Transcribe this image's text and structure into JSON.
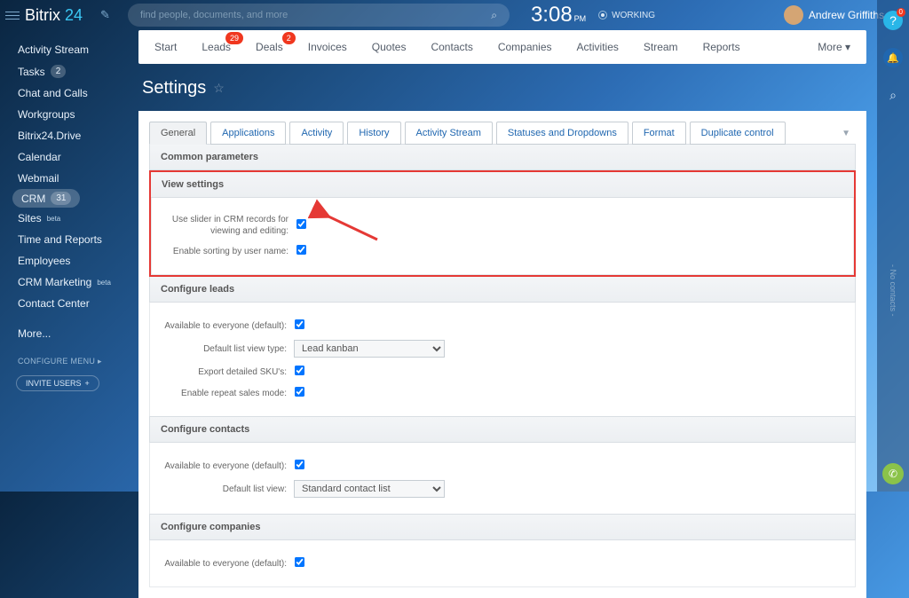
{
  "logo": {
    "a": "Bitrix",
    "b": "24"
  },
  "search": {
    "placeholder": "find people, documents, and more"
  },
  "clock": {
    "time": "3:08",
    "ampm": "PM"
  },
  "status": "WORKING",
  "user": {
    "name": "Andrew Griffiths"
  },
  "rail": {
    "help_badge": "0",
    "vtext": "- No contacts -"
  },
  "sidebar": {
    "items": [
      {
        "label": "Activity Stream"
      },
      {
        "label": "Tasks",
        "badge": "2"
      },
      {
        "label": "Chat and Calls"
      },
      {
        "label": "Workgroups"
      },
      {
        "label": "Bitrix24.Drive"
      },
      {
        "label": "Calendar"
      },
      {
        "label": "Webmail"
      },
      {
        "label": "CRM",
        "badge": "31"
      },
      {
        "label": "Sites",
        "sup": "beta"
      },
      {
        "label": "Time and Reports"
      },
      {
        "label": "Employees"
      },
      {
        "label": "CRM Marketing",
        "sup": "beta"
      },
      {
        "label": "Contact Center"
      },
      {
        "label": "More..."
      }
    ],
    "configure": "CONFIGURE MENU",
    "invite": "INVITE USERS"
  },
  "crmnav": {
    "items": [
      "Start",
      "Leads",
      "Deals",
      "Invoices",
      "Quotes",
      "Contacts",
      "Companies",
      "Activities",
      "Stream",
      "Reports"
    ],
    "badges": {
      "1": "29",
      "2": "2"
    },
    "more": "More"
  },
  "page_title": "Settings",
  "tabs": [
    "General",
    "Applications",
    "Activity",
    "History",
    "Activity Stream",
    "Statuses and Dropdowns",
    "Format",
    "Duplicate control"
  ],
  "sections": {
    "common": "Common parameters",
    "view": {
      "title": "View settings",
      "opt1": "Use slider in CRM records for viewing and editing:",
      "opt2": "Enable sorting by user name:"
    },
    "leads": {
      "title": "Configure leads",
      "opt1": "Available to everyone (default):",
      "opt2": "Default list view type:",
      "opt2_val": "Lead kanban",
      "opt3": "Export detailed SKU's:",
      "opt4": "Enable repeat sales mode:"
    },
    "contacts": {
      "title": "Configure contacts",
      "opt1": "Available to everyone (default):",
      "opt2": "Default list view:",
      "opt2_val": "Standard contact list"
    },
    "companies": {
      "title": "Configure companies",
      "opt1": "Available to everyone (default):"
    }
  }
}
